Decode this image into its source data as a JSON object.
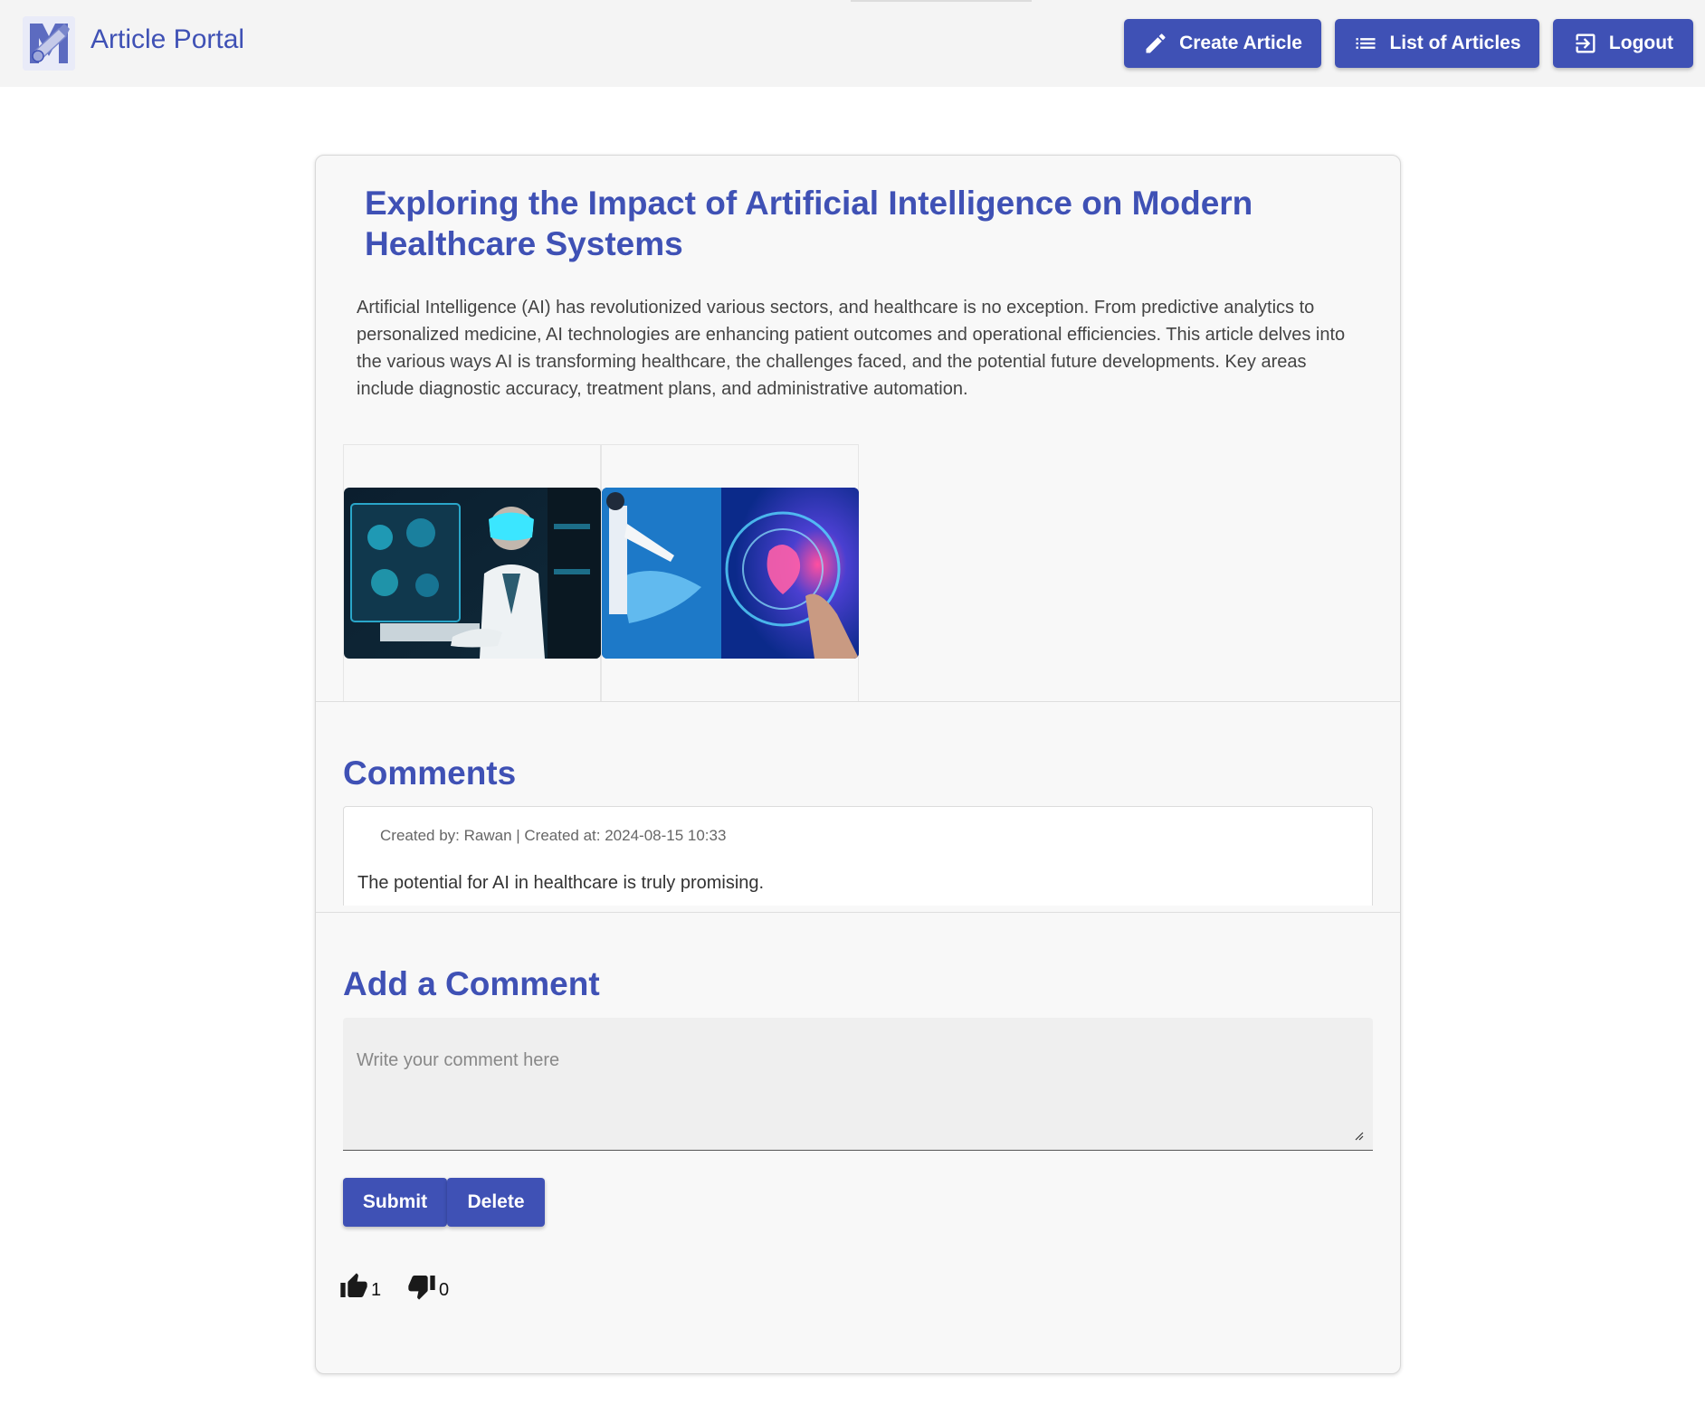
{
  "header": {
    "brand": "Article Portal",
    "nav": {
      "create": "Create Article",
      "list": "List of Articles",
      "logout": "Logout"
    }
  },
  "article": {
    "title": "Exploring the Impact of Artificial Intelligence on Modern Healthcare Systems",
    "body": "Artificial Intelligence (AI) has revolutionized various sectors, and healthcare is no exception. From predictive analytics to personalized medicine, AI technologies are enhancing patient outcomes and operational efficiencies. This article delves into the various ways AI is transforming healthcare, the challenges faced, and the potential future developments. Key areas include diagnostic accuracy, treatment plans, and administrative automation."
  },
  "comments": {
    "heading": "Comments",
    "items": [
      {
        "meta": "Created by: Rawan | Created at: 2024-08-15 10:33",
        "text": "The potential for AI in healthcare is truly promising."
      }
    ]
  },
  "add_comment": {
    "heading": "Add a Comment",
    "placeholder": "Write your comment here",
    "submit_label": "Submit",
    "delete_label": "Delete"
  },
  "votes": {
    "likes": "1",
    "dislikes": "0"
  },
  "colors": {
    "accent": "#3f51b5",
    "topbar_bg": "#f4f4f4",
    "card_bg": "#f8f8f8"
  }
}
